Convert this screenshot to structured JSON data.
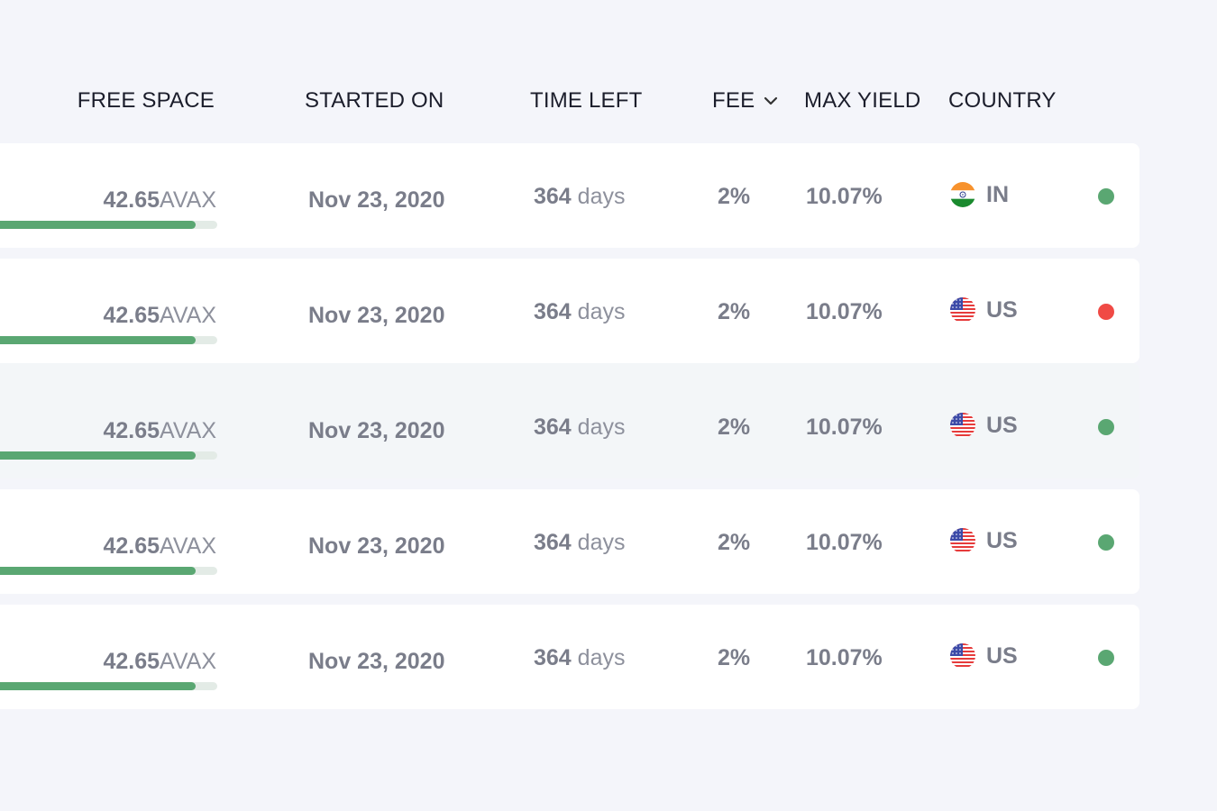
{
  "header": {
    "free_space": "FREE SPACE",
    "started_on": "STARTED ON",
    "time_left": "TIME LEFT",
    "fee": "FEE",
    "max_yield": "MAX YIELD",
    "country": "COUNTRY"
  },
  "colors": {
    "status_online": "#5aa772",
    "status_offline": "#f04a45",
    "bar_fill": "#5aa772"
  },
  "rows": [
    {
      "free_value": "42.65",
      "free_unit": "AVAX",
      "free_ratio": 0.9,
      "started": "Nov 23, 2020",
      "time_value": "364",
      "time_unit": "days",
      "fee": "2%",
      "max_yield": "10.07%",
      "country": "IN",
      "flag_icon": "india-flag-icon",
      "status": "online"
    },
    {
      "free_value": "42.65",
      "free_unit": "AVAX",
      "free_ratio": 0.9,
      "started": "Nov 23, 2020",
      "time_value": "364",
      "time_unit": "days",
      "fee": "2%",
      "max_yield": "10.07%",
      "country": "US",
      "flag_icon": "us-flag-icon",
      "status": "offline"
    },
    {
      "free_value": "42.65",
      "free_unit": "AVAX",
      "free_ratio": 0.9,
      "started": "Nov 23, 2020",
      "time_value": "364",
      "time_unit": "days",
      "fee": "2%",
      "max_yield": "10.07%",
      "country": "US",
      "flag_icon": "us-flag-icon",
      "status": "online"
    },
    {
      "free_value": "42.65",
      "free_unit": "AVAX",
      "free_ratio": 0.9,
      "started": "Nov 23, 2020",
      "time_value": "364",
      "time_unit": "days",
      "fee": "2%",
      "max_yield": "10.07%",
      "country": "US",
      "flag_icon": "us-flag-icon",
      "status": "online"
    },
    {
      "free_value": "42.65",
      "free_unit": "AVAX",
      "free_ratio": 0.9,
      "started": "Nov 23, 2020",
      "time_value": "364",
      "time_unit": "days",
      "fee": "2%",
      "max_yield": "10.07%",
      "country": "US",
      "flag_icon": "us-flag-icon",
      "status": "online"
    }
  ]
}
